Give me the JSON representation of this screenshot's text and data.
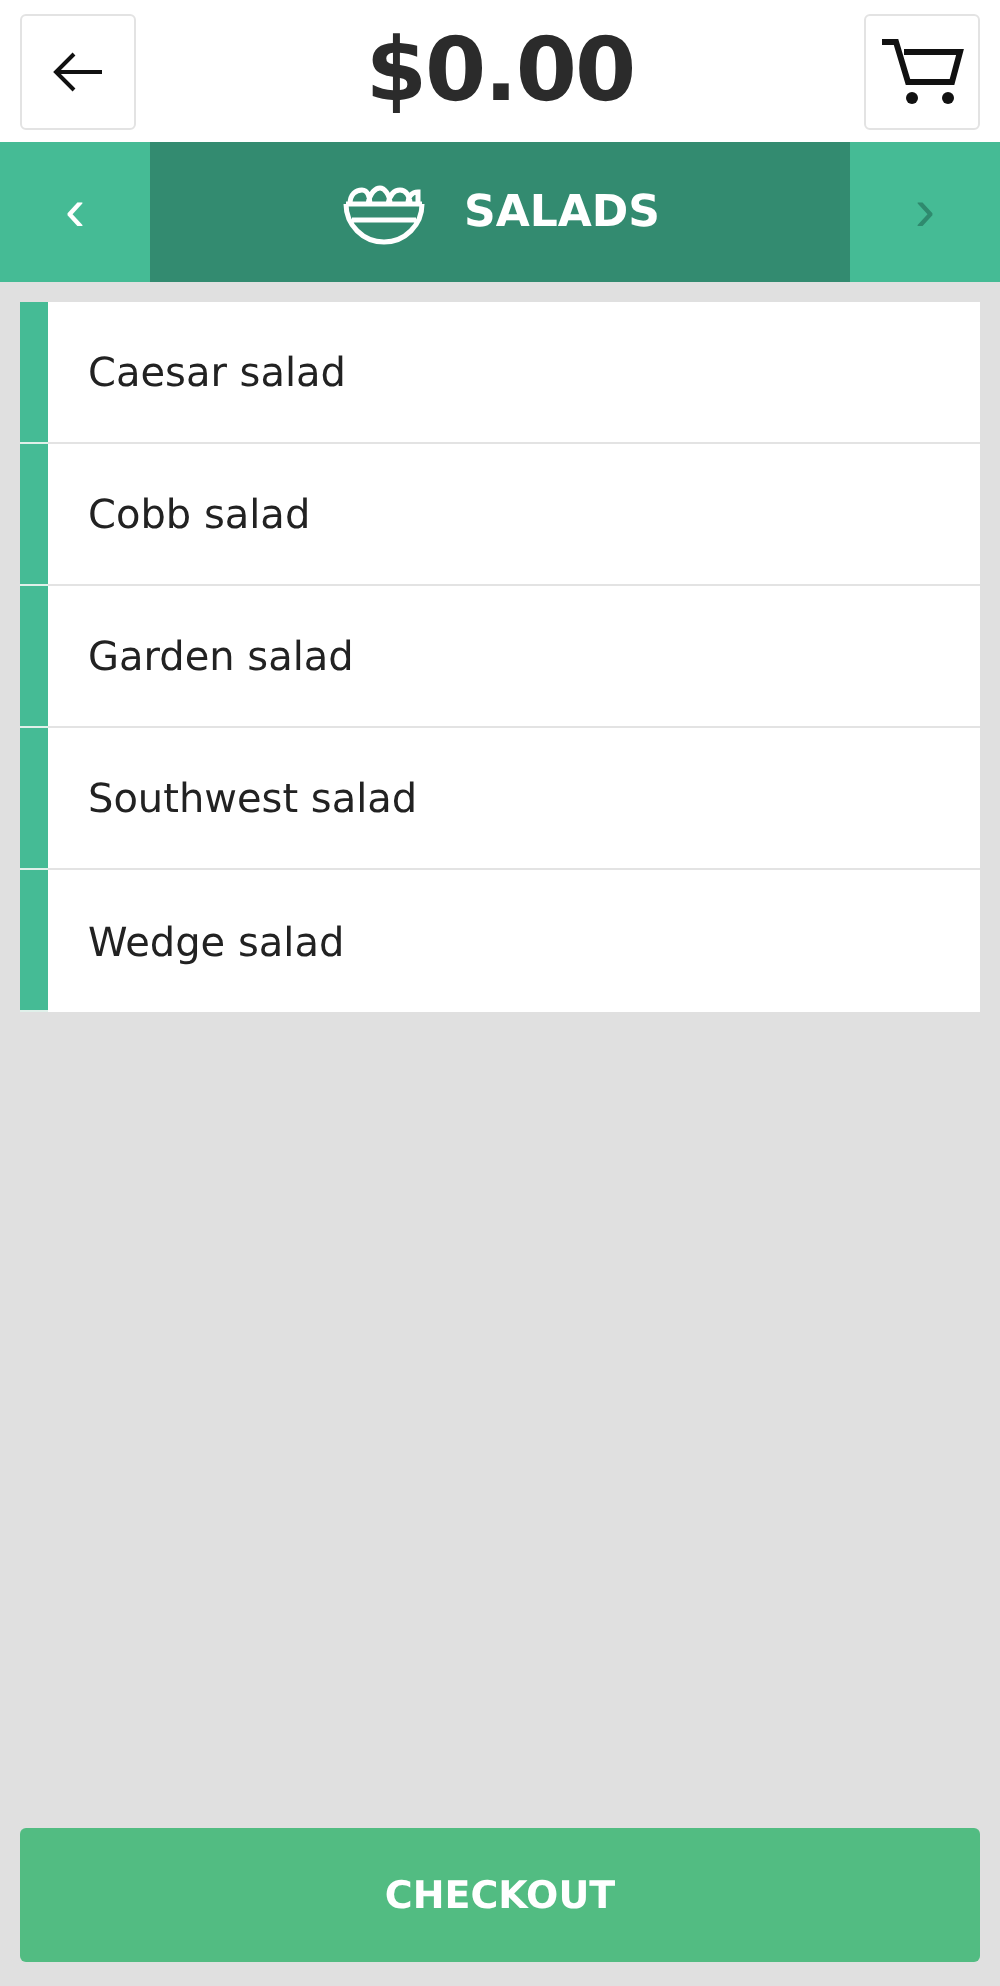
{
  "header": {
    "total": "$0.00"
  },
  "category_bar": {
    "title": "SALADS",
    "prev": {
      "label": "‹",
      "disabled": false
    },
    "next": {
      "label": "›",
      "disabled": true
    }
  },
  "items": [
    {
      "name": "Caesar salad"
    },
    {
      "name": "Cobb salad"
    },
    {
      "name": "Garden salad"
    },
    {
      "name": "Southwest salad"
    },
    {
      "name": "Wedge salad"
    }
  ],
  "checkout": {
    "label": "CHECKOUT"
  }
}
